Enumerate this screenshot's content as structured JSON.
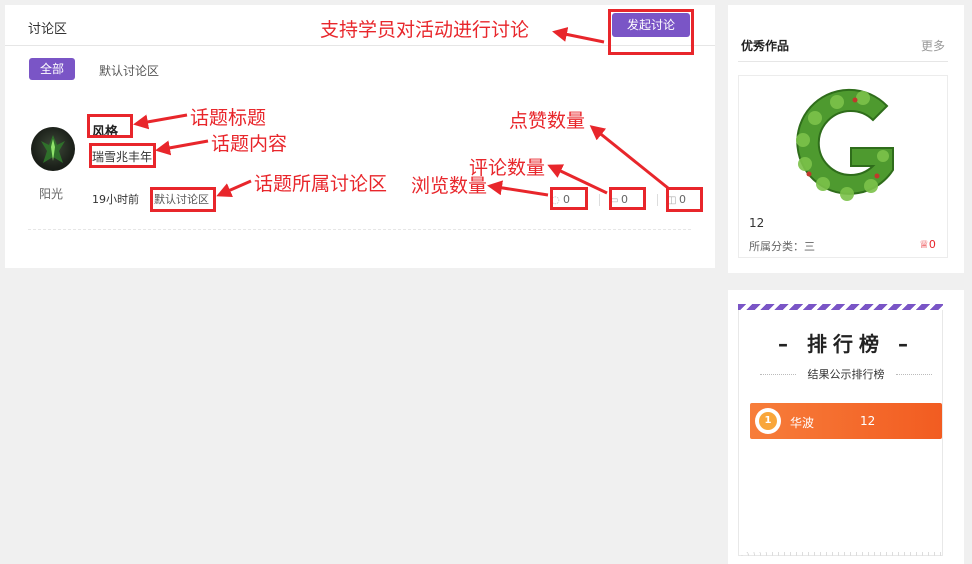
{
  "discussion": {
    "title": "讨论区",
    "start_button": "发起讨论",
    "tabs": [
      {
        "label": "全部",
        "active": true
      },
      {
        "label": "默认讨论区",
        "active": false
      }
    ],
    "topic": {
      "author": "阳光",
      "title": "风格",
      "content": "瑞雪兆丰年",
      "time": "19小时前",
      "area": "默认讨论区",
      "views": "0",
      "comments": "0",
      "likes": "0"
    }
  },
  "annotations": {
    "discuss": "支持学员对活动进行讨论",
    "topic_title": "话题标题",
    "topic_content": "话题内容",
    "topic_area": "话题所属讨论区",
    "views": "浏览数量",
    "comments": "评论数量",
    "likes": "点赞数量"
  },
  "works": {
    "title": "优秀作品",
    "more": "更多",
    "item": {
      "name": "12",
      "category": "所属分类：三",
      "likes": "0"
    }
  },
  "ranking": {
    "title": "– 排行榜 –",
    "subtitle": "结果公示排行榜",
    "rows": [
      {
        "rank": "1",
        "name": "华波",
        "score": "12"
      }
    ]
  },
  "colors": {
    "accent": "#7a55c6",
    "annotation": "#e8262b",
    "rank_row": "#f25c21"
  }
}
